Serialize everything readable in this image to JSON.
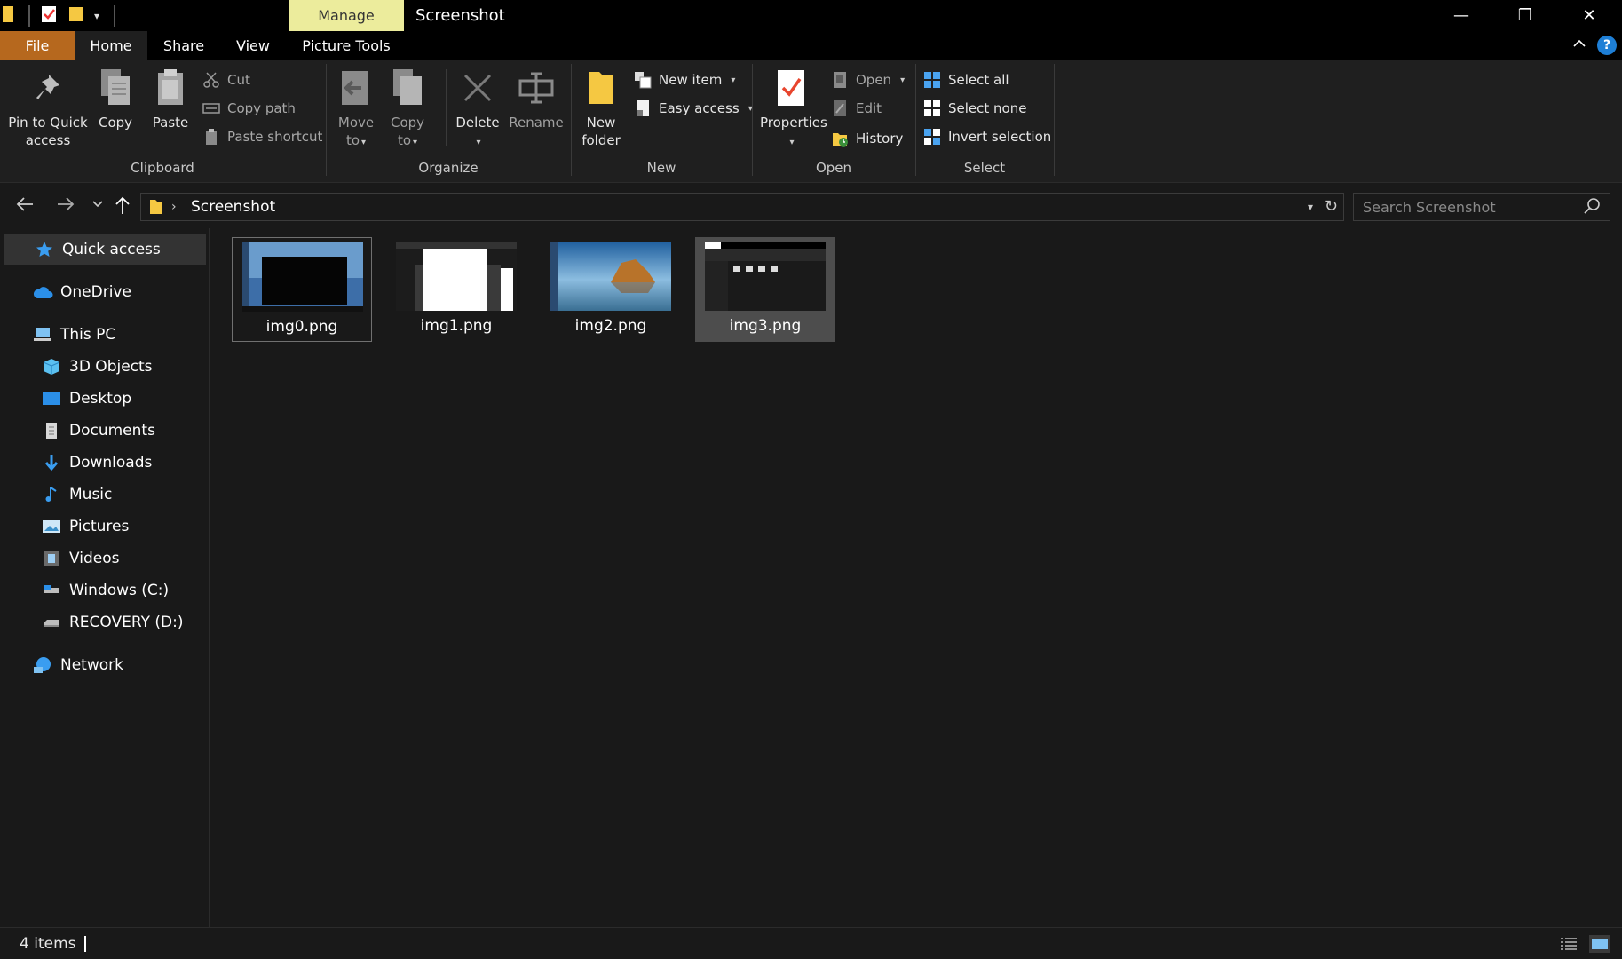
{
  "titlebar": {
    "manage_tab": "Manage",
    "title": "Screenshot",
    "minimize_glyph": "—",
    "restore_glyph": "❐",
    "close_glyph": "✕"
  },
  "tabs": {
    "file": "File",
    "home": "Home",
    "share": "Share",
    "view": "View",
    "picture_tools": "Picture Tools",
    "help_glyph": "?"
  },
  "ribbon": {
    "clipboard": {
      "label": "Clipboard",
      "pin": "Pin to Quick access",
      "copy": "Copy",
      "paste": "Paste",
      "cut": "Cut",
      "copy_path": "Copy path",
      "paste_shortcut": "Paste shortcut"
    },
    "organize": {
      "label": "Organize",
      "move_to": "Move to",
      "copy_to": "Copy to",
      "delete": "Delete",
      "rename": "Rename"
    },
    "new": {
      "label": "New",
      "new_folder": "New folder",
      "new_item": "New item",
      "easy_access": "Easy access"
    },
    "open": {
      "label": "Open",
      "properties": "Properties",
      "open": "Open",
      "edit": "Edit",
      "history": "History"
    },
    "select": {
      "label": "Select",
      "select_all": "Select all",
      "select_none": "Select none",
      "invert_selection": "Invert selection"
    }
  },
  "address": {
    "crumb": "Screenshot",
    "search_placeholder": "Search Screenshot"
  },
  "sidebar": {
    "items": [
      {
        "label": "Quick access",
        "icon": "star-icon"
      },
      {
        "label": "OneDrive",
        "icon": "cloud-icon"
      },
      {
        "label": "This PC",
        "icon": "computer-icon"
      },
      {
        "label": "3D Objects",
        "icon": "cube-icon"
      },
      {
        "label": "Desktop",
        "icon": "desktop-icon"
      },
      {
        "label": "Documents",
        "icon": "document-icon"
      },
      {
        "label": "Downloads",
        "icon": "download-icon"
      },
      {
        "label": "Music",
        "icon": "music-icon"
      },
      {
        "label": "Pictures",
        "icon": "pictures-icon"
      },
      {
        "label": "Videos",
        "icon": "videos-icon"
      },
      {
        "label": "Windows (C:)",
        "icon": "drive-icon"
      },
      {
        "label": "RECOVERY (D:)",
        "icon": "drive-icon"
      },
      {
        "label": "Network",
        "icon": "network-icon"
      }
    ]
  },
  "files": [
    {
      "name": "img0.png"
    },
    {
      "name": "img1.png"
    },
    {
      "name": "img2.png"
    },
    {
      "name": "img3.png"
    }
  ],
  "status": {
    "count": "4 items"
  },
  "colors": {
    "file_tab": "#b6681e",
    "manage_tab": "#ecec9c",
    "accent_blue": "#1e7fd6",
    "background": "#191919"
  }
}
